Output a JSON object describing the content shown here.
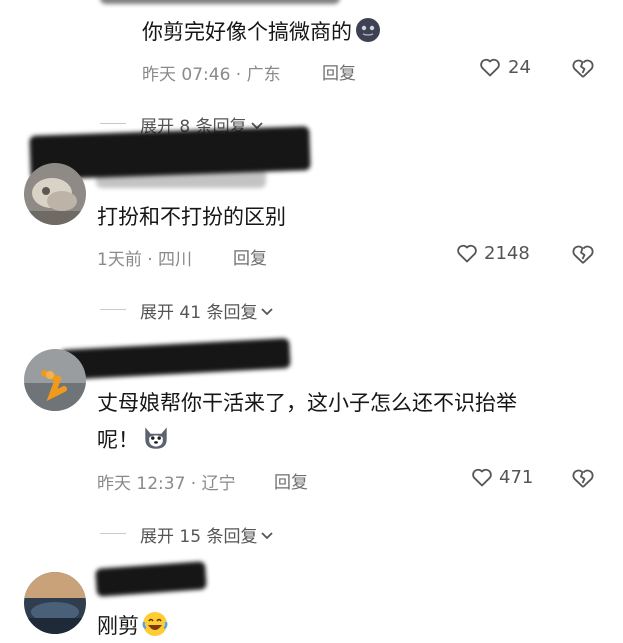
{
  "comments": [
    {
      "text": "你剪完好像个搞微商的",
      "emoji": "dark-round-face-emoji",
      "meta": "昨天 07:46 · 广东",
      "reply_label": "回复",
      "likes": "24"
    },
    {
      "text": "打扮和不打扮的区别",
      "meta": "1天前 · 四川",
      "reply_label": "回复",
      "likes": "2148"
    },
    {
      "text_line1": "丈母娘帮你干活来了，这小子怎么还不识抬举",
      "text_line2": "呢！",
      "emoji": "husky-dog-emoji",
      "meta": "昨天 12:37 · 辽宁",
      "reply_label": "回复",
      "likes": "471"
    },
    {
      "text": "刚剪",
      "emoji": "laugh-cry-emoji"
    }
  ],
  "expanders": [
    {
      "label": "展开 8 条回复"
    },
    {
      "label": "展开 41 条回复"
    },
    {
      "label": "展开 15 条回复"
    }
  ],
  "icons": {
    "like": "heart-outline-icon",
    "dislike": "broken-heart-icon",
    "expand": "chevron-down-icon"
  },
  "colors": {
    "text": "#161616",
    "meta": "#8a8a8a",
    "divider": "#c9c9c9",
    "redaction": "#161616"
  }
}
